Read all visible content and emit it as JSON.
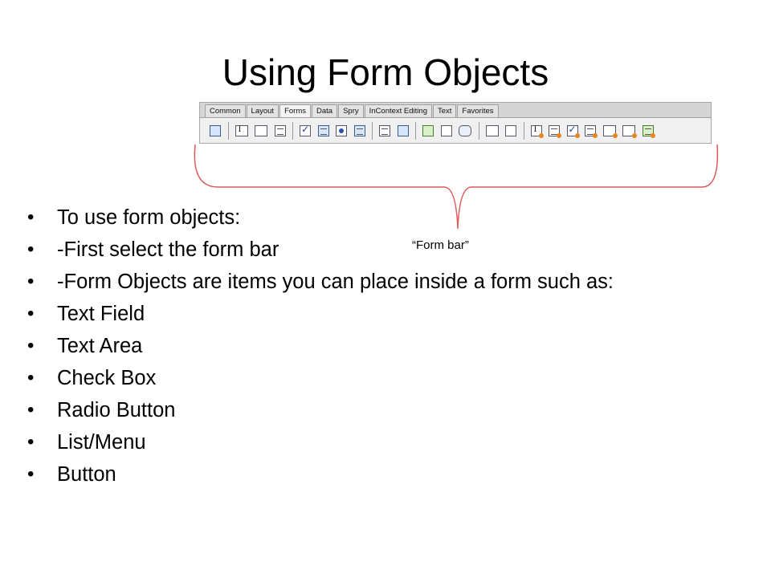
{
  "slide": {
    "title": "Using Form Objects",
    "caption": "“Form bar”"
  },
  "toolbar": {
    "tabs": [
      "Common",
      "Layout",
      "Forms",
      "Data",
      "Spry",
      "InContext Editing",
      "Text",
      "Favorites"
    ],
    "active_tab": "Forms",
    "icons": [
      "form-icon",
      "text-field-icon",
      "hidden-field-icon",
      "textarea-icon",
      "checkbox-icon",
      "checkbox-group-icon",
      "radio-button-icon",
      "radio-group-icon",
      "list-menu-icon",
      "jump-menu-icon",
      "image-field-icon",
      "file-field-icon",
      "button-icon",
      "label-icon",
      "fieldset-icon",
      "spry-text-field-icon",
      "spry-textarea-icon",
      "spry-checkbox-icon",
      "spry-select-icon",
      "spry-password-icon",
      "spry-confirm-icon",
      "spry-radio-group-icon"
    ]
  },
  "bullets": [
    "To use form objects:",
    "-First select the form bar",
    "-Form Objects are items you can place inside a form such as:",
    "Text Field",
    "Text Area",
    "Check Box",
    "Radio Button",
    "List/Menu",
    "Button"
  ],
  "colors": {
    "brace": "#e05a5a",
    "toolbar_bg": "#d5d5d5"
  }
}
